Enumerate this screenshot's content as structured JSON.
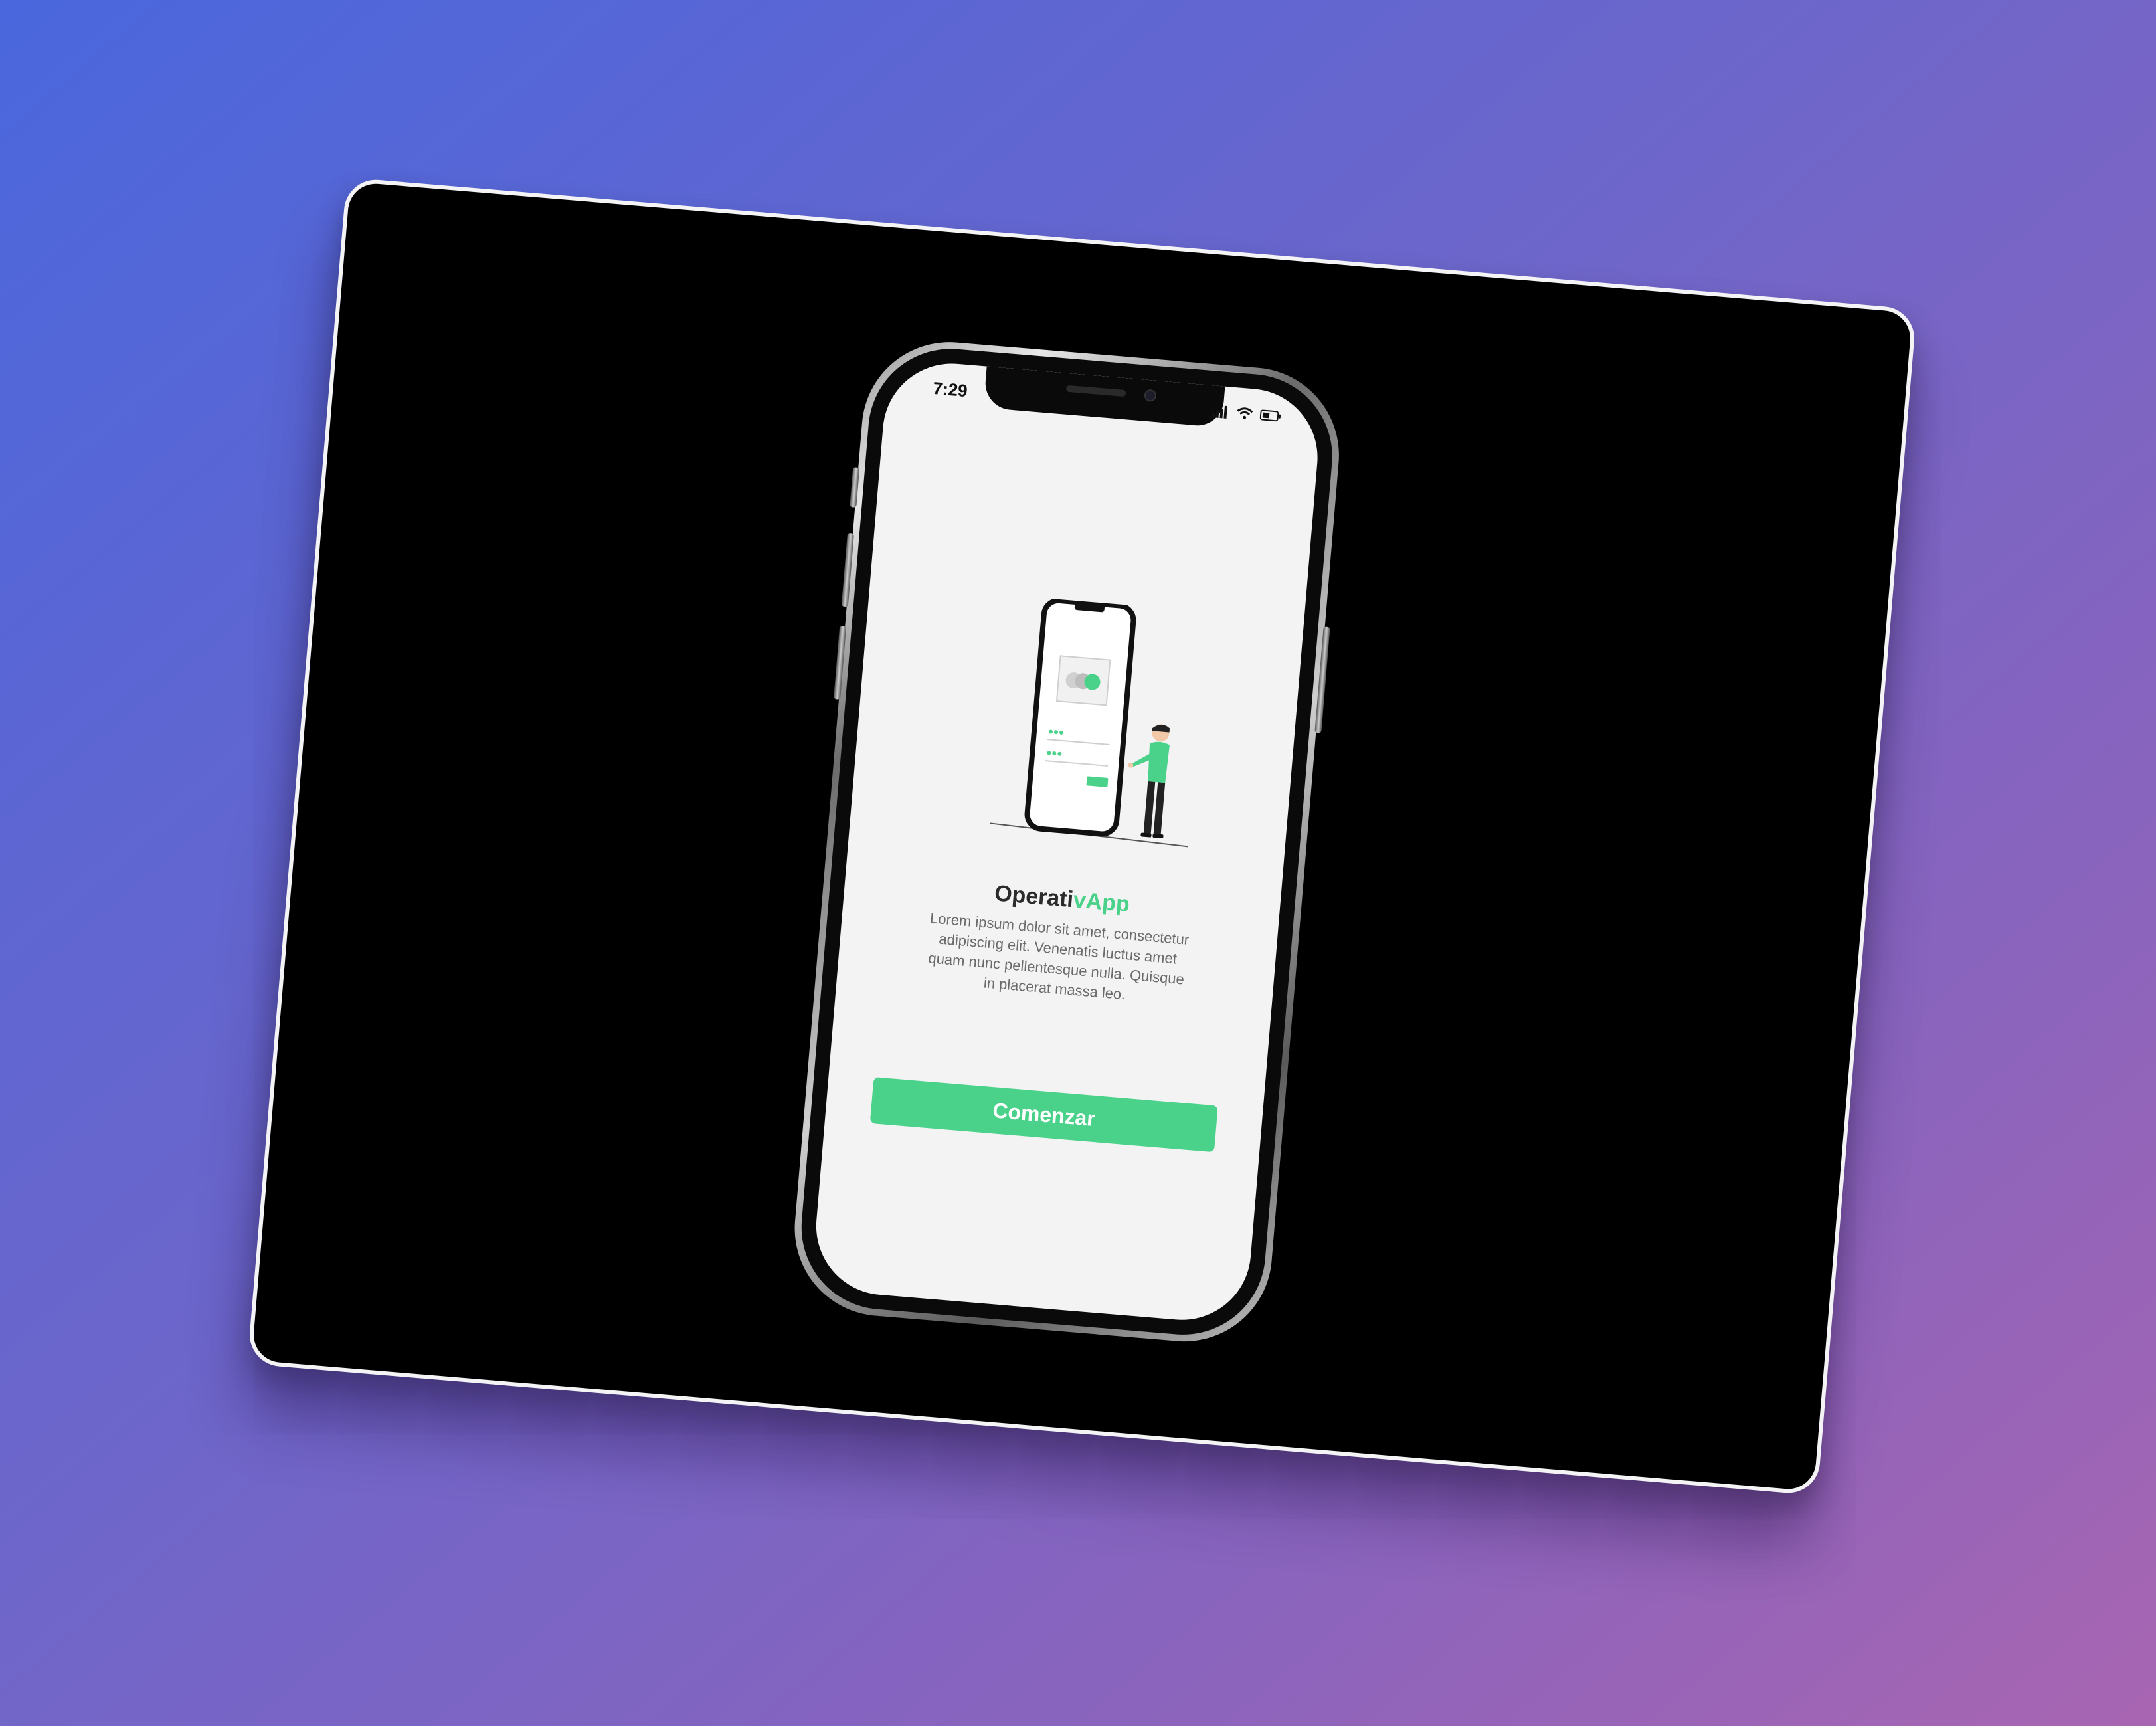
{
  "status_bar": {
    "time": "7:29",
    "icons": [
      "signal-icon",
      "wifi-icon",
      "battery-icon"
    ]
  },
  "app": {
    "title_part1": "Operati",
    "title_part2": "vApp",
    "description": "Lorem ipsum dolor sit amet, consectetur adipiscing elit. Venenatis luctus amet quam nunc pellentesque nulla. Quisque in placerat massa leo.",
    "cta_label": "Comenzar"
  },
  "colors": {
    "accent": "#4bd28a",
    "screen_bg": "#f3f3f3",
    "card_bg": "#000000"
  }
}
